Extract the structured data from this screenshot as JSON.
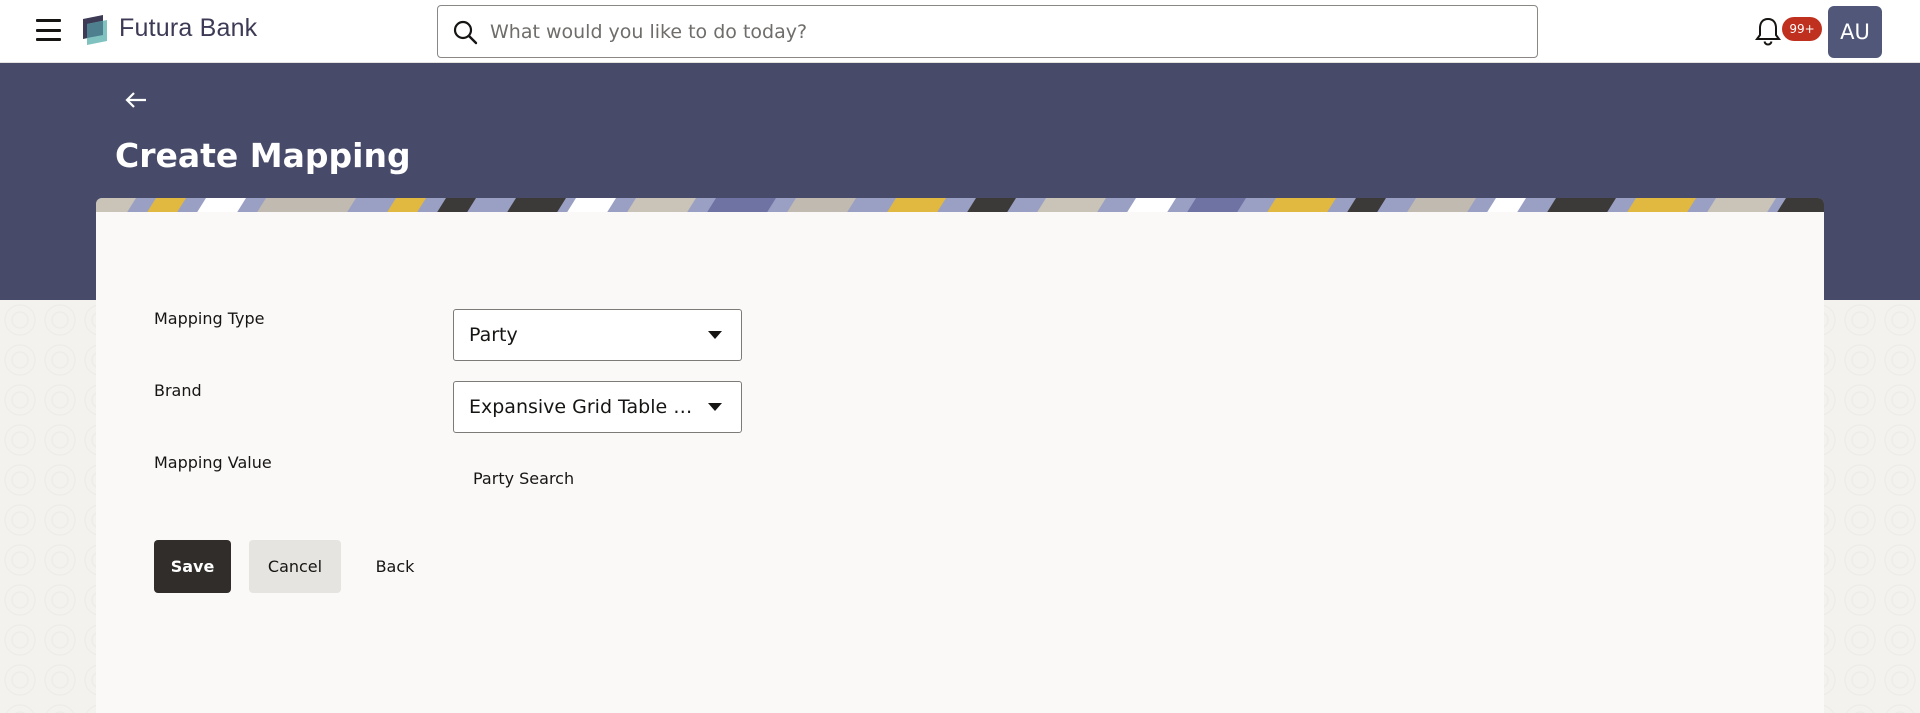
{
  "header": {
    "brand_name": "Futura Bank",
    "search_placeholder": "What would you like to do today?",
    "notification_count": "99+",
    "avatar_initials": "AU"
  },
  "page": {
    "title": "Create Mapping"
  },
  "form": {
    "mapping_type_label": "Mapping Type",
    "mapping_type_value": "Party",
    "brand_label": "Brand",
    "brand_value": "Expansive Grid Table Brand",
    "mapping_value_label": "Mapping Value",
    "party_search_label": "Party Search"
  },
  "actions": {
    "save_label": "Save",
    "cancel_label": "Cancel",
    "back_label": "Back"
  },
  "colors": {
    "banner": "#474b69",
    "primary_button": "#312d2a",
    "badge": "#c0301e",
    "avatar": "#505779"
  }
}
